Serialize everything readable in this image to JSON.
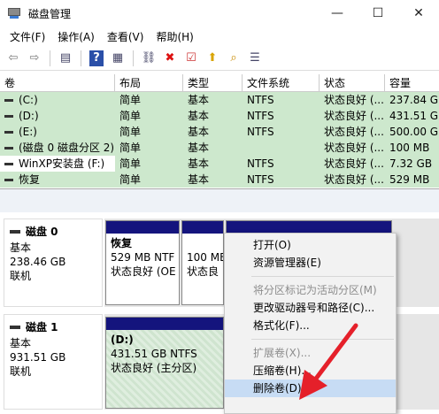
{
  "window": {
    "title": "磁盘管理",
    "minimize_glyph": "—",
    "maximize_glyph": "☐",
    "close_glyph": "✕"
  },
  "menu": [
    "文件(F)",
    "操作(A)",
    "查看(V)",
    "帮助(H)"
  ],
  "toolbar": [
    {
      "icon": "back-arrow-icon",
      "glyph": "⇦"
    },
    {
      "icon": "forward-arrow-icon",
      "glyph": "⇨"
    },
    {
      "icon": "console-tree-icon",
      "glyph": "▤"
    },
    {
      "icon": "help-icon",
      "glyph": "?"
    },
    {
      "icon": "properties-icon",
      "glyph": "▦"
    },
    {
      "icon": "connect-icon",
      "glyph": "⛓"
    },
    {
      "icon": "delete-icon",
      "glyph": "✖"
    },
    {
      "icon": "check-icon",
      "glyph": "☑"
    },
    {
      "icon": "up-icon",
      "glyph": "⬆"
    },
    {
      "icon": "search-icon",
      "glyph": "⌕"
    },
    {
      "icon": "list-icon",
      "glyph": "☰"
    }
  ],
  "volumes": {
    "headers": [
      "卷",
      "布局",
      "类型",
      "文件系统",
      "状态",
      "容量"
    ],
    "rows": [
      [
        "(C:)",
        "简单",
        "基本",
        "NTFS",
        "状态良好 (...",
        "237.84 G"
      ],
      [
        "(D:)",
        "简单",
        "基本",
        "NTFS",
        "状态良好 (...",
        "431.51 G"
      ],
      [
        "(E:)",
        "简单",
        "基本",
        "NTFS",
        "状态良好 (...",
        "500.00 G"
      ],
      [
        "(磁盘 0 磁盘分区 2)",
        "简单",
        "基本",
        "",
        "状态良好 (...",
        "100 MB"
      ],
      [
        "WinXP安装盘 (F:)",
        "简单",
        "基本",
        "NTFS",
        "状态良好 (...",
        "7.32 GB"
      ],
      [
        "恢复",
        "简单",
        "基本",
        "NTFS",
        "状态良好 (...",
        "529 MB"
      ]
    ]
  },
  "disk0": {
    "name": "磁盘 0",
    "type": "基本",
    "size": "238.46 GB",
    "status": "联机",
    "part1": {
      "name": "恢复",
      "size": "529 MB NTF",
      "status": "状态良好 (OE"
    },
    "part2": {
      "size": "100 MB",
      "status": "状态良"
    }
  },
  "disk1": {
    "name": "磁盘 1",
    "type": "基本",
    "size": "931.51 GB",
    "status": "联机",
    "part1": {
      "name": "(D:)",
      "size": "431.51 GB NTFS",
      "status": "状态良好 (主分区)"
    }
  },
  "context_menu": {
    "items": [
      {
        "label": "打开(O)",
        "disabled": false
      },
      {
        "label": "资源管理器(E)",
        "disabled": false
      },
      {
        "sep": true
      },
      {
        "label": "将分区标记为活动分区(M)",
        "disabled": true
      },
      {
        "label": "更改驱动器号和路径(C)...",
        "disabled": false
      },
      {
        "label": "格式化(F)...",
        "disabled": false
      },
      {
        "sep": true
      },
      {
        "label": "扩展卷(X)...",
        "disabled": true
      },
      {
        "label": "压缩卷(H)...",
        "disabled": false
      },
      {
        "label": "删除卷(D)...",
        "disabled": false,
        "highlighted": true
      }
    ]
  },
  "colors": {
    "volume_row_bg": "#cde8cd",
    "partition_header": "#14147d",
    "highlight": "#c7dcf4",
    "arrow": "#e5202a"
  }
}
